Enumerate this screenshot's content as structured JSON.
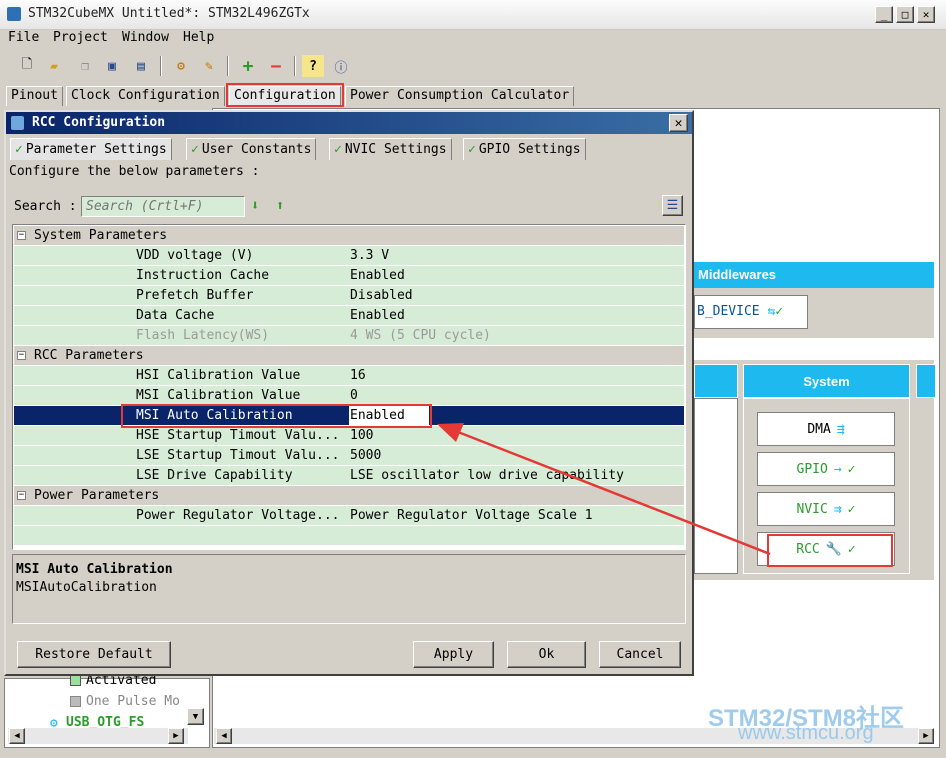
{
  "window": {
    "title": "STM32CubeMX Untitled*: STM32L496ZGTx"
  },
  "menu": [
    "File",
    "Project",
    "Window",
    "Help"
  ],
  "toolbar": {
    "icons": [
      "new-project-icon",
      "open-icon",
      "copy-icon",
      "save-icon",
      "save-as-icon",
      "generate-code-icon",
      "report-icon",
      "add-icon",
      "remove-icon",
      "help-icon",
      "about-icon"
    ]
  },
  "main_tabs": [
    "Pinout",
    "Clock Configuration",
    "Configuration",
    "Power Consumption Calculator"
  ],
  "background": {
    "middlewares": "Middlewares",
    "usb_device": "B_DEVICE",
    "system": "System",
    "system_buttons": [
      "DMA",
      "GPIO",
      "NVIC",
      "RCC"
    ],
    "tree": [
      "Activated",
      "One Pulse Mo",
      "USB_OTG_FS"
    ]
  },
  "dialog": {
    "title": "RCC Configuration",
    "tabs": [
      "Parameter Settings",
      "User Constants",
      "NVIC Settings",
      "GPIO Settings"
    ],
    "instruction": "Configure the below parameters :",
    "search_label": "Search :",
    "search_placeholder": "Search (Crtl+F)",
    "groups": [
      {
        "name": "System Parameters",
        "params": [
          {
            "name": "VDD voltage (V)",
            "value": "3.3 V"
          },
          {
            "name": "Instruction Cache",
            "value": "Enabled"
          },
          {
            "name": "Prefetch Buffer",
            "value": "Disabled"
          },
          {
            "name": "Data Cache",
            "value": "Enabled"
          },
          {
            "name": "Flash Latency(WS)",
            "value": "4 WS (5 CPU cycle)",
            "disabled": true
          }
        ]
      },
      {
        "name": "RCC Parameters",
        "params": [
          {
            "name": "HSI Calibration Value",
            "value": "16"
          },
          {
            "name": "MSI Calibration Value",
            "value": "0"
          },
          {
            "name": "MSI Auto Calibration",
            "value": "Enabled",
            "selected": true
          },
          {
            "name": "HSE Startup Timout Valu...",
            "value": "100"
          },
          {
            "name": "LSE Startup Timout Valu...",
            "value": "5000"
          },
          {
            "name": "LSE Drive Capability",
            "value": "LSE oscillator low drive capability"
          }
        ]
      },
      {
        "name": "Power Parameters",
        "params": [
          {
            "name": "Power Regulator Voltage...",
            "value": "Power Regulator Voltage Scale 1"
          }
        ]
      }
    ],
    "description": {
      "title": "MSI Auto Calibration",
      "text": "MSIAutoCalibration"
    },
    "buttons": {
      "restore": "Restore Default",
      "apply": "Apply",
      "ok": "Ok",
      "cancel": "Cancel"
    }
  },
  "watermark": {
    "line1": "STM32/STM8社区",
    "line2": "www.stmcu.org"
  },
  "colors": {
    "accent": "#1db9ef",
    "selection": "#0a246a",
    "row": "#d7ecd7",
    "highlight": "#e53935"
  }
}
